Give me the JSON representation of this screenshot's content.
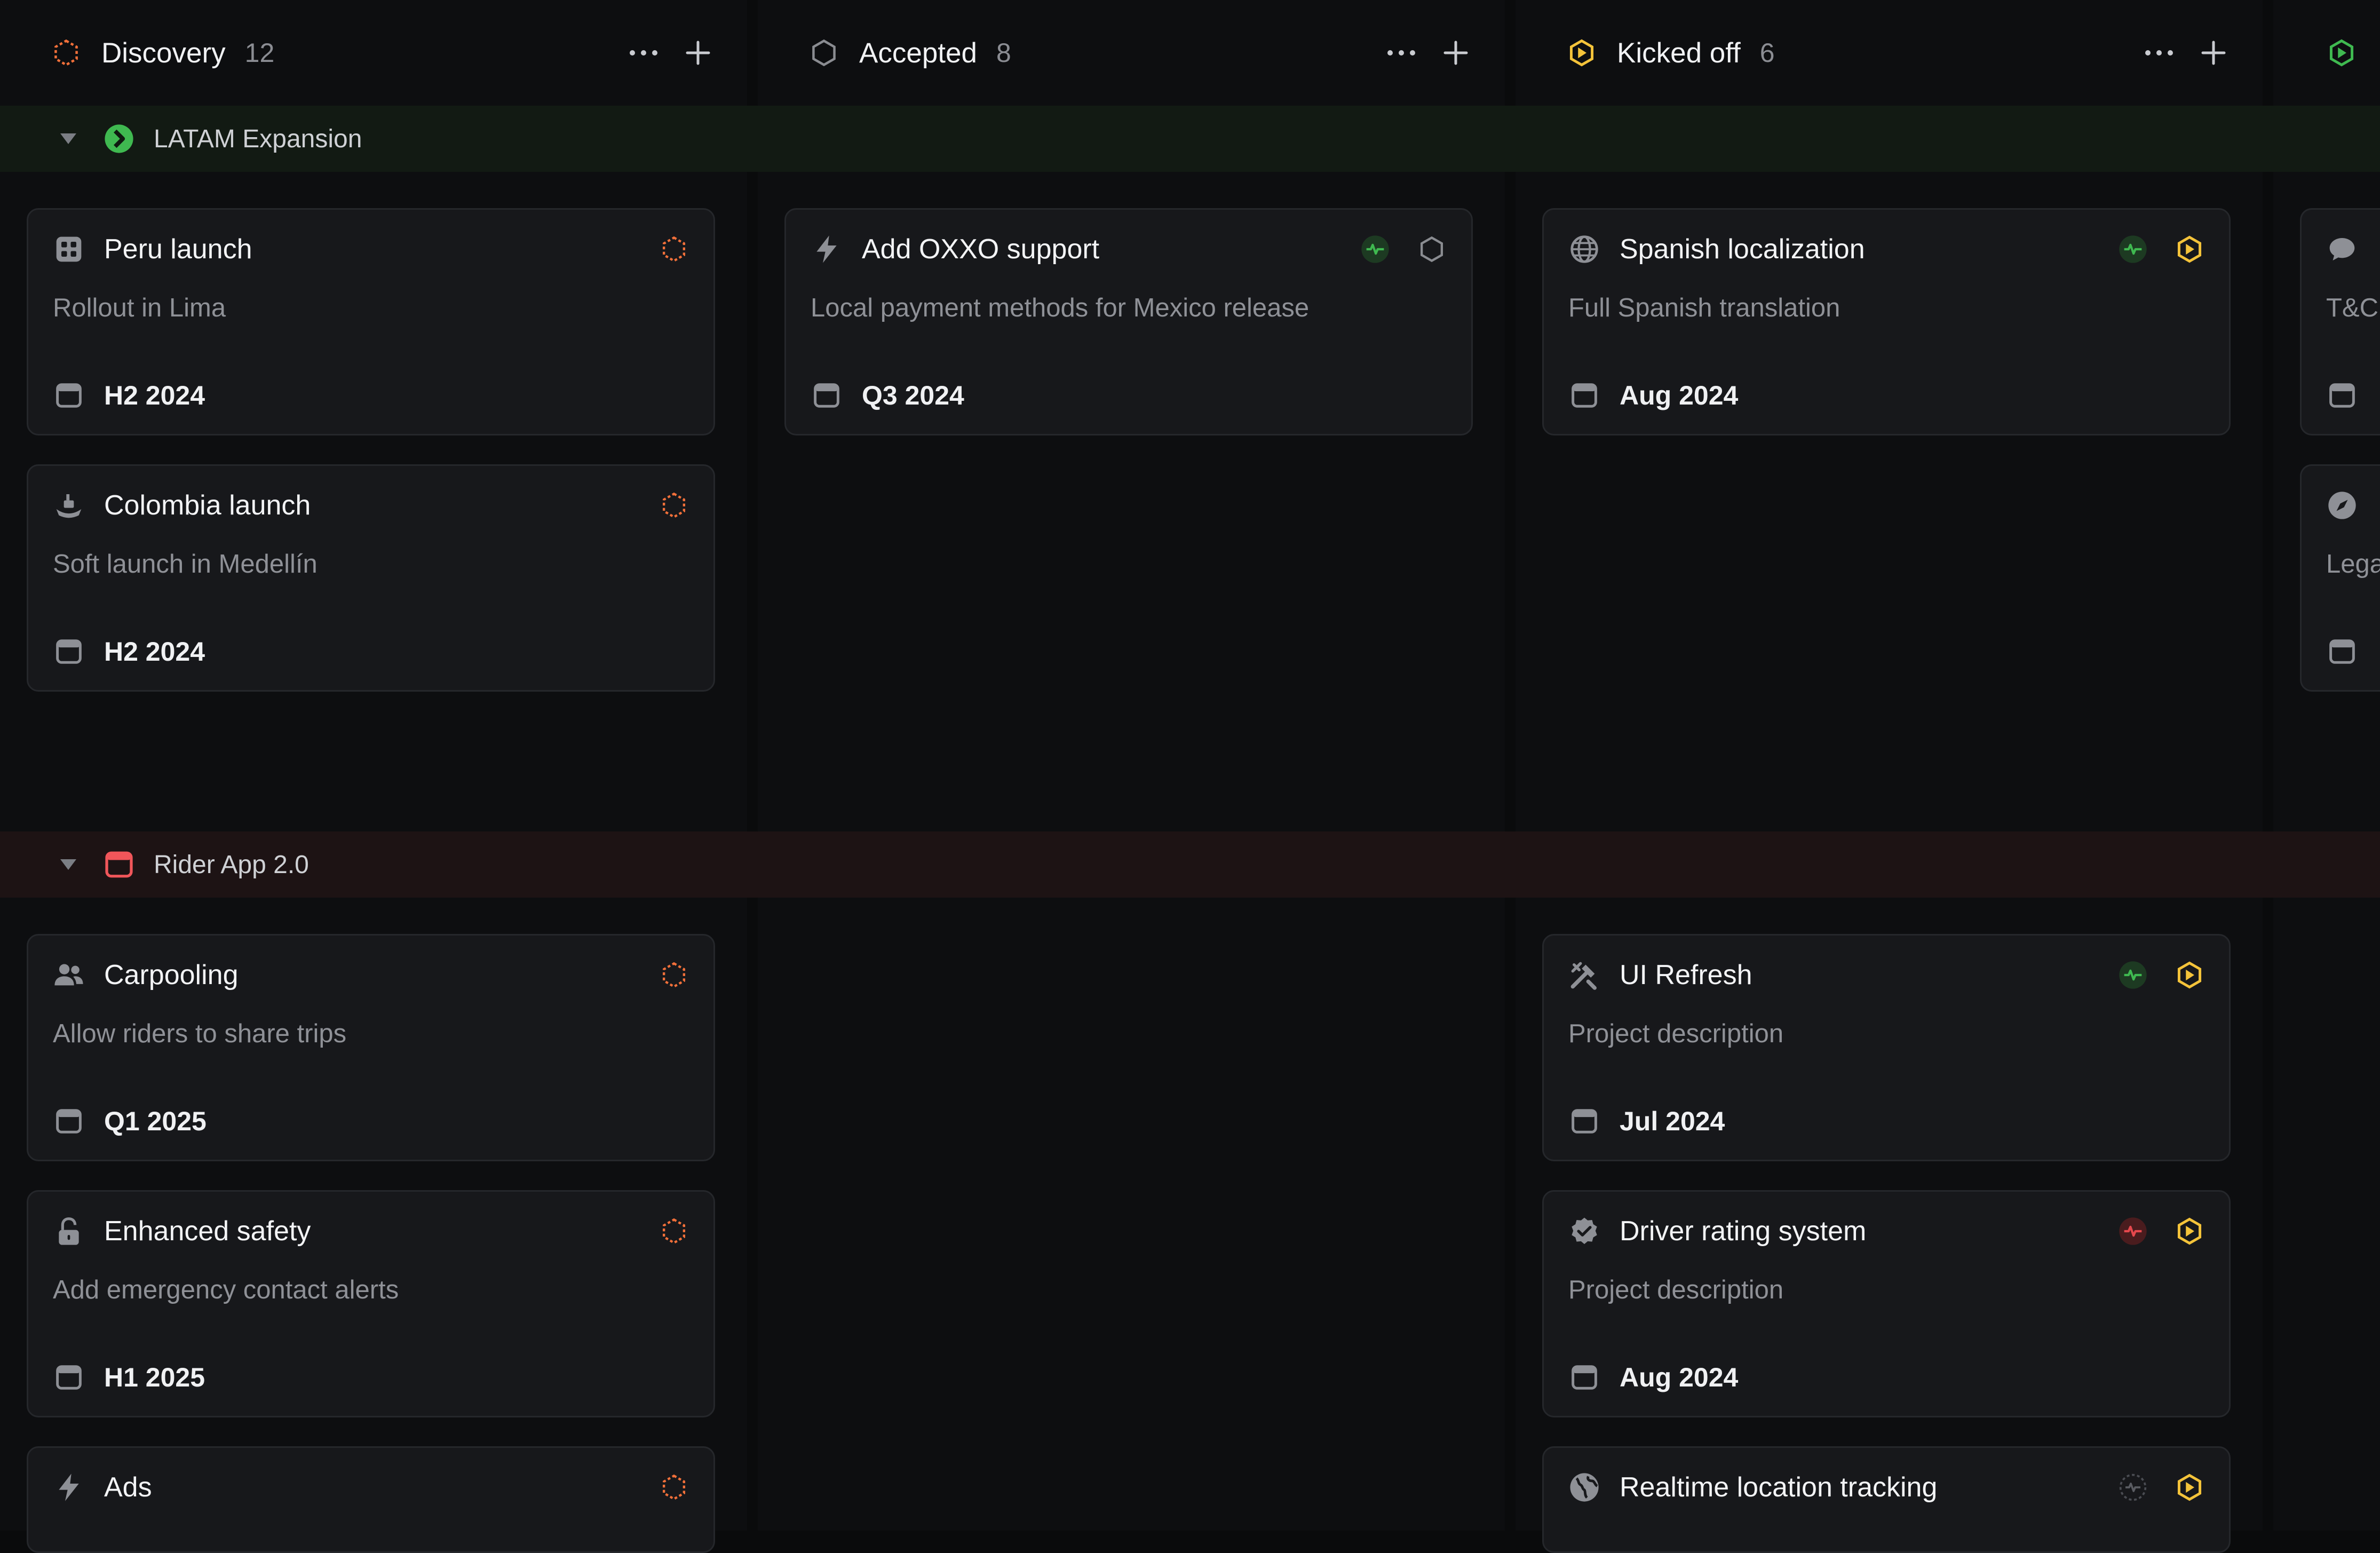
{
  "columns": [
    {
      "title": "Discovery",
      "count": "12",
      "status_icon": "discovery-status-icon",
      "status_color": "#f2703a"
    },
    {
      "title": "Accepted",
      "count": "8",
      "status_icon": "accepted-status-icon",
      "status_color": "#8a8c91"
    },
    {
      "title": "Kicked off",
      "count": "6",
      "status_icon": "kicked-off-status-icon",
      "status_color": "#f4c33a"
    }
  ],
  "column_actions": {
    "more": "more-icon",
    "add": "plus-icon"
  },
  "groups": [
    {
      "name": "LATAM Expansion",
      "icon": "latam-group-icon",
      "color": "#3fb950"
    },
    {
      "name": "Rider App 2.0",
      "icon": "calendar-group-icon",
      "color": "#f0565a"
    }
  ],
  "cards": {
    "latam": {
      "discovery": [
        {
          "title": "Peru launch",
          "desc": "Rollout in Lima",
          "date": "H2 2024",
          "icon": "grid-icon"
        },
        {
          "title": "Colombia launch",
          "desc": "Soft launch in Medellín",
          "date": "H2 2024",
          "icon": "ship-icon"
        }
      ],
      "accepted": [
        {
          "title": "Add OXXO support",
          "desc": "Local payment methods for Mexico release",
          "date": "Q3 2024",
          "icon": "bolt-icon"
        }
      ],
      "kicked": [
        {
          "title": "Spanish localization",
          "desc": "Full Spanish translation",
          "date": "Aug 2024",
          "icon": "globe-icon"
        }
      ],
      "fourth": [
        {
          "desc": "T&C",
          "icon": "chat-icon"
        },
        {
          "desc": "Lega",
          "icon": "compass-icon"
        }
      ]
    },
    "rider": {
      "discovery": [
        {
          "title": "Carpooling",
          "desc": "Allow riders to share trips",
          "date": "Q1 2025",
          "icon": "users-icon"
        },
        {
          "title": "Enhanced safety",
          "desc": "Add emergency contact alerts",
          "date": "H1 2025",
          "icon": "lock-icon"
        },
        {
          "title": "Ads",
          "icon": "bolt-icon"
        }
      ],
      "kicked": [
        {
          "title": "UI Refresh",
          "desc": "Project description",
          "date": "Jul 2024",
          "icon": "tools-icon",
          "health": "on-track"
        },
        {
          "title": "Driver rating system",
          "desc": "Project description",
          "date": "Aug 2024",
          "icon": "verified-icon",
          "health": "off-track"
        },
        {
          "title": "Realtime location tracking",
          "icon": "globe-filled-icon",
          "health": "none"
        }
      ]
    }
  },
  "colors": {
    "on_track": "#3fb950",
    "off_track": "#e5484d",
    "discovery": "#f2703a",
    "kicked_off": "#f4c33a"
  }
}
